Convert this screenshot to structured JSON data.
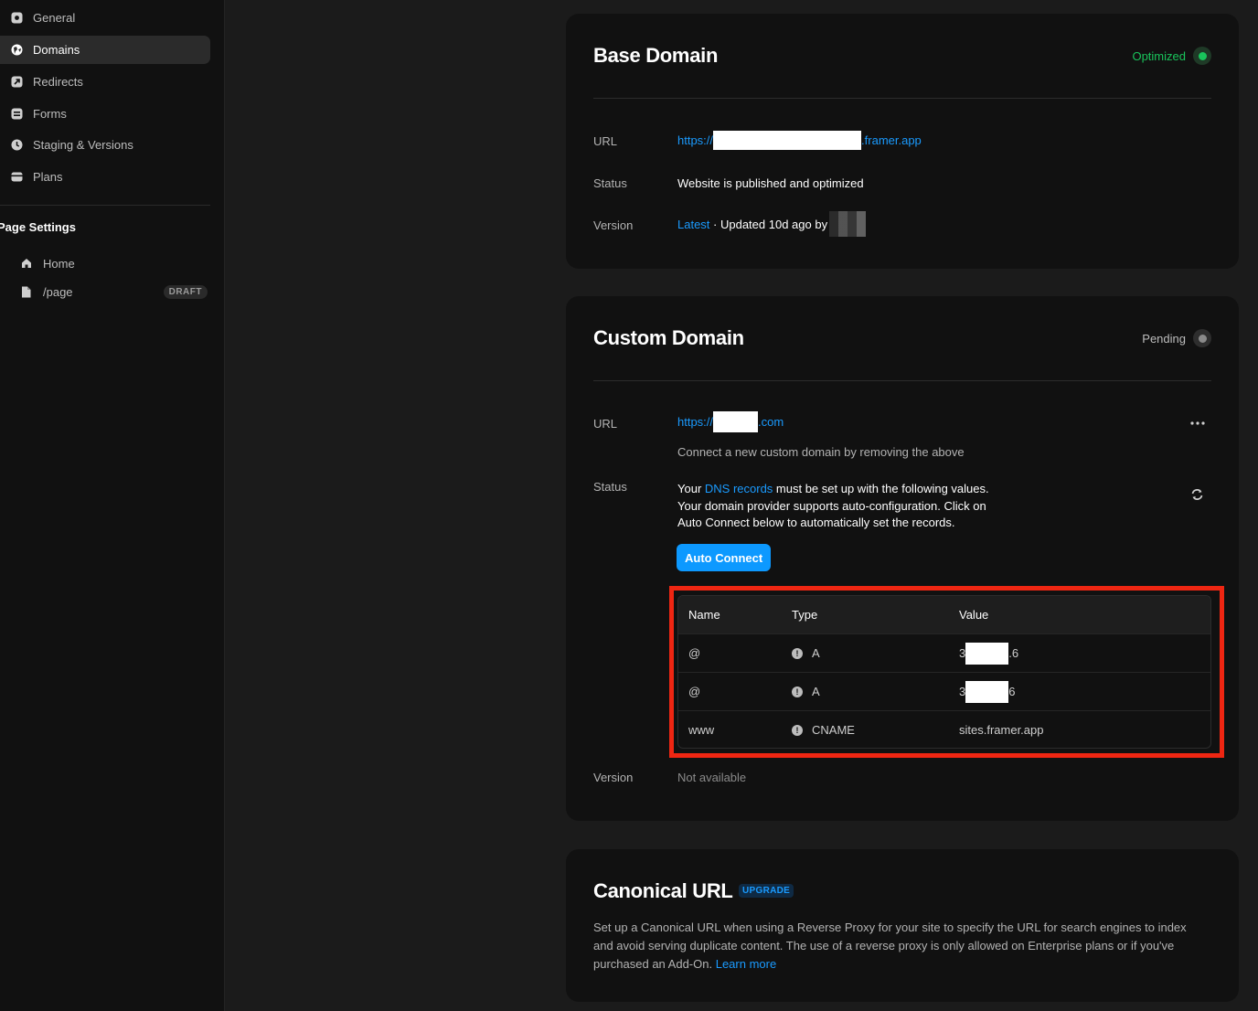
{
  "sidebar": {
    "items": [
      {
        "label": "General",
        "icon": "general-icon",
        "active": false
      },
      {
        "label": "Domains",
        "icon": "globe-icon",
        "active": true
      },
      {
        "label": "Redirects",
        "icon": "redirect-icon",
        "active": false
      },
      {
        "label": "Forms",
        "icon": "form-icon",
        "active": false
      },
      {
        "label": "Staging & Versions",
        "icon": "clock-icon",
        "active": false
      },
      {
        "label": "Plans",
        "icon": "card-icon",
        "active": false
      }
    ],
    "page_settings_title": "Page Settings",
    "pages": [
      {
        "label": "Home",
        "icon": "home-icon",
        "badge": ""
      },
      {
        "label": "/page",
        "icon": "file-icon",
        "badge": "DRAFT"
      }
    ]
  },
  "base_domain": {
    "title": "Base Domain",
    "status_label": "Optimized",
    "status_color": "#19c45b",
    "url_label": "URL",
    "url_prefix": "https://",
    "url_suffix": ".framer.app",
    "status_row_label": "Status",
    "status_text": "Website is published and optimized",
    "version_label": "Version",
    "version_link": "Latest",
    "version_text": " · Updated 10d ago by"
  },
  "custom_domain": {
    "title": "Custom Domain",
    "status_label": "Pending",
    "url_label": "URL",
    "url_prefix": "https://",
    "url_suffix": ".com",
    "url_hint": "Connect a new custom domain by removing the above",
    "status_row_label": "Status",
    "status_line1_prefix": "Your ",
    "status_line1_link": "DNS records",
    "status_line1_suffix": " must be set up with the following values.",
    "status_line2": "Your domain provider supports auto-configuration. Click on",
    "status_line3": "Auto Connect below to automatically set the records.",
    "auto_connect_label": "Auto Connect",
    "dns_headers": {
      "name": "Name",
      "type": "Type",
      "value": "Value"
    },
    "dns_records": [
      {
        "name": "@",
        "type": "A",
        "value_prefix": "3",
        "value_suffix": ".6"
      },
      {
        "name": "@",
        "type": "A",
        "value_prefix": "3",
        "value_suffix": "6"
      },
      {
        "name": "www",
        "type": "CNAME",
        "value_prefix": "sites.framer.app",
        "value_suffix": ""
      }
    ],
    "version_label": "Version",
    "version_text": "Not available"
  },
  "canonical": {
    "title": "Canonical URL",
    "badge": "UPGRADE",
    "description": "Set up a Canonical URL when using a Reverse Proxy for your site to specify the URL for search engines to index and avoid serving duplicate content. The use of a reverse proxy is only allowed on Enterprise plans or if you've purchased an Add-On.",
    "learn_more": "Learn more"
  },
  "colors": {
    "accent": "#0d99ff",
    "link": "#1a9bff",
    "highlight": "#ef2612",
    "pending": "#8a8a8a"
  }
}
